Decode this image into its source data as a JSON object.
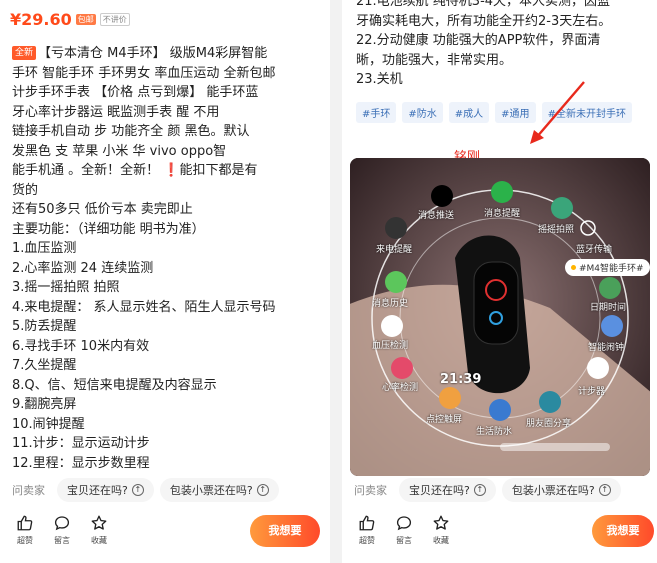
{
  "left": {
    "price": "¥29.60",
    "tag_baoyou": "包邮",
    "tag_noprice": "不讲价",
    "new_badge": "全新",
    "desc_lines": [
      "【亏本清仓 M4手环】  级版M4彩屏智能",
      "手环 智能手环 手环男女  率血压运动 全新包邮",
      "计步手环手表 【价格  点亏到爆】  能手环蓝",
      "牙心率计步器运  眠监测手表  醒 不用",
      "链接手机自动  步 功能齐全 颜  黑色。默认",
      "发黑色 支  苹果 小米 华  vivo oppo智",
      "能手机通  。全新！全新！",
      "货的",
      "还有50多只   低价亏本  卖完即止",
      "主要功能：（详细功能  明书为准）",
      "1.血压监测",
      "2.心率监测    24  连续监测",
      "3.摇一摇拍照   拍照",
      "4.来电提醒：  系人显示姓名、陌生人显示号码",
      "5.防丢提醒",
      "6.寻找手环    10米内有效",
      "7.久坐提醒",
      "8.Q、信、短信来电提醒及内容显示",
      "9.翻腕亮屏",
      "10.闹钟提醒",
      "11.计步：显示运动计步",
      "12.里程：显示步数里程"
    ],
    "red_mark": "❗",
    "red_mark_suffix": "能扣下都是有",
    "ask_label": "问卖家",
    "questions": [
      "宝贝还在吗?",
      "包装小票还在吗?"
    ],
    "actions": [
      "超赞",
      "留言",
      "收藏"
    ],
    "bargain_label": "我想要"
  },
  "right": {
    "top_lines": [
      "21.电池续航  纯待机3-4天，本人实测，因蓝",
      "牙确实耗电大，所有功能全开约2-3天左右。",
      "22.分动健康  功能强大的APP软件，界面清",
      "晰，功能强大，非常实用。",
      "23.关机"
    ],
    "tags": [
      "#手环",
      "#防水",
      "#成人",
      "#通用",
      "#全新未开封手环"
    ],
    "watermark": "铭刚",
    "photo_labels": {
      "qq": "消息推送",
      "wechat": "消息提醒",
      "camera": "摇摇拍照",
      "bluetooth": "蓝牙传输",
      "call": "来电提醒",
      "sms": "消息历史",
      "date": "日期时间",
      "bp": "血压检测",
      "alarm": "智能闹钟",
      "heart": "心率检测",
      "steps": "计步器",
      "touch": "点控触屏",
      "water": "生活防水",
      "share": "朋友圈分享"
    },
    "photo_badge": "#M4智能手环#",
    "watch_time": "21:39",
    "ask_label": "问卖家",
    "questions": [
      "宝贝还在吗?",
      "包装小票还在吗?"
    ],
    "actions": [
      "超赞",
      "留言",
      "收藏"
    ],
    "bargain_label": "我想要"
  }
}
